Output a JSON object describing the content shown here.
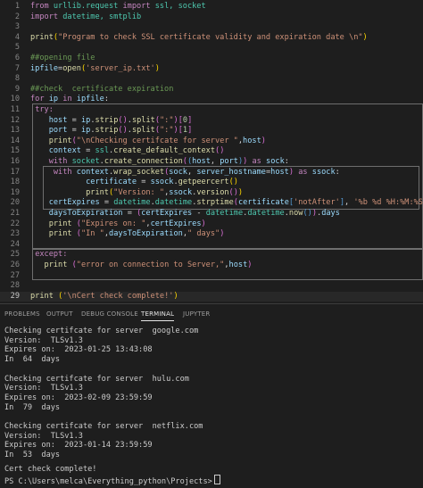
{
  "editor": {
    "line_numbers": [
      "1",
      "2",
      "3",
      "4",
      "5",
      "6",
      "7",
      "8",
      "9",
      "10",
      "11",
      "12",
      "13",
      "14",
      "15",
      "16",
      "17",
      "18",
      "19",
      "20",
      "21",
      "22",
      "23",
      "24",
      "25",
      "26",
      "27",
      "28",
      "29"
    ],
    "tokens": {
      "from": "from",
      "import": "import",
      "urllib_request": " urllib.request ",
      "ssl_socket": " ssl, socket",
      "datetime_smtplib_a": " datetime, ",
      "smtplib": "smtplib",
      "print": "print",
      "title_str": "\"Program to check SSL certificate validity and expiration date \\n\"",
      "comment_opening": "##opening file",
      "ipfile": "ipfile",
      "open": "open",
      "server_ip_txt": "'server_ip.txt'",
      "comment_check": "##check  certificate expiration",
      "for": "for",
      "ip": "ip",
      "in": "in",
      "try": "try:",
      "host": "host",
      "strip": "strip",
      "split": "split",
      "colon_str": "\":\"",
      "zero": "0",
      "port": "port",
      "one": "1",
      "checking_str": "\"\\nChecking certifcate for server \"",
      "context": "context",
      "ssl": "ssl",
      "create_default_context": "create_default_context",
      "with": "with",
      "socket": "socket",
      "create_connection": "create_connection",
      "as": "as",
      "sock": "sock",
      "wrap_socket": "wrap_socket",
      "server_hostname": "server_hostname",
      "ssock": "ssock",
      "certificate": "certificate",
      "getpeercert": "getpeercert",
      "version_str": "\"Version: \"",
      "version": "version",
      "certExpires": "certExpires",
      "datetime": "datetime",
      "strptime": "strptime",
      "notAfter": "'notAfter'",
      "date_fmt": "'%b %d %H:%M:%S %Y %Z'",
      "daysToExpiration": "daysToExpiration",
      "now": "now",
      "days": "days",
      "expires_str": "\"Expires on: \"",
      "in_str": "\"In \"",
      "days_str": "\" days\"",
      "except": "except:",
      "error_str": "\"error on connection to Server,\"",
      "cert_complete_str": "'\\nCert check complete!'"
    }
  },
  "panel": {
    "tabs": [
      "PROBLEMS",
      "OUTPUT",
      "DEBUG CONSOLE",
      "TERMINAL",
      "JUPYTER"
    ],
    "active_tab": "TERMINAL"
  },
  "terminal": {
    "lines": [
      "Checking certifcate for server  google.com",
      "Version:  TLSv1.3",
      "Expires on:  2023-01-25 13:43:08",
      "In  64  days",
      "",
      "Checking certifcate for server  hulu.com",
      "Version:  TLSv1.3",
      "Expires on:  2023-02-09 23:59:59",
      "In  79  days",
      "",
      "Checking certifcate for server  netflix.com",
      "Version:  TLSv1.3",
      "Expires on:  2023-01-14 23:59:59",
      "In  53  days",
      "",
      "Cert check complete!"
    ],
    "prompt": "PS C:\\Users\\melca\\Everything_python\\Projects>"
  }
}
